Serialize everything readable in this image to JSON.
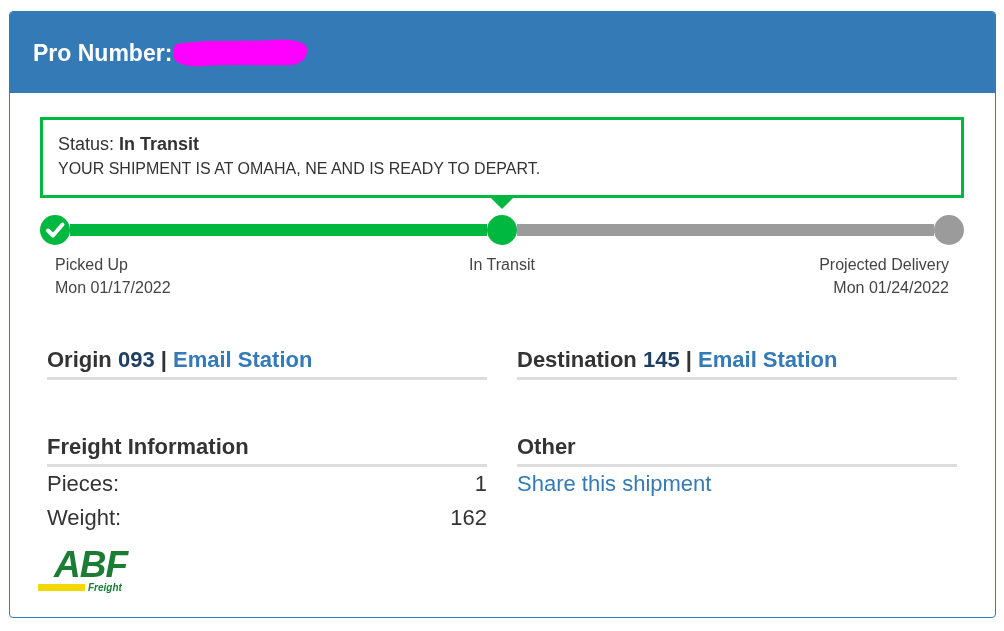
{
  "header": {
    "label": "Pro Number:"
  },
  "status": {
    "label": "Status:",
    "value": "In Transit",
    "message": "YOUR SHIPMENT IS AT OMAHA, NE AND IS READY TO DEPART."
  },
  "progress": {
    "steps": [
      {
        "kind": "done",
        "label": "Picked Up",
        "date": "Mon 01/17/2022"
      },
      {
        "kind": "current",
        "label": "In Transit"
      },
      {
        "kind": "pending",
        "label": "Projected Delivery",
        "date": "Mon 01/24/2022"
      }
    ]
  },
  "stations": [
    {
      "title": "Origin",
      "code": "093",
      "separator": "|",
      "link": "Email Station"
    },
    {
      "title": "Destination",
      "code": "145",
      "separator": "|",
      "link": "Email Station"
    }
  ],
  "freight": {
    "title": "Freight Information",
    "rows": [
      {
        "label": "Pieces:",
        "value": "1"
      },
      {
        "label": "Weight:",
        "value": "162"
      }
    ]
  },
  "other": {
    "title": "Other",
    "link": "Share this shipment"
  },
  "logo": {
    "mark": "ABF",
    "tagline": "Freight"
  }
}
